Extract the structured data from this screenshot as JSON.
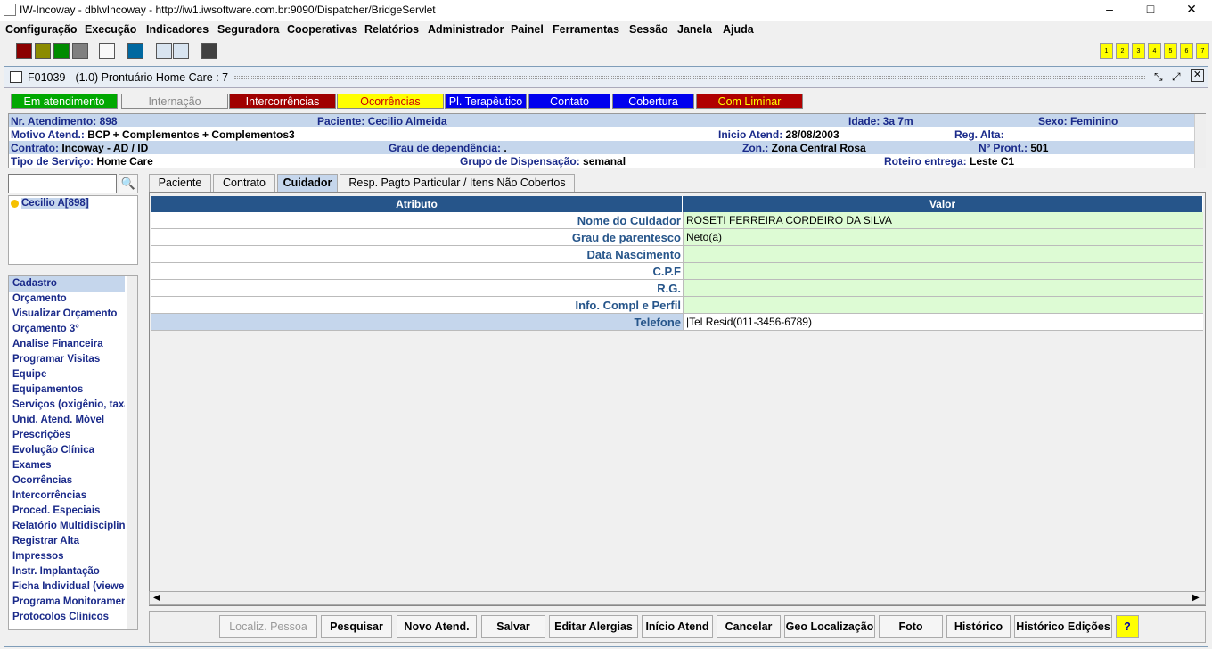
{
  "window": {
    "title": "IW-Incoway - dblwIncoway - http://iw1.iwsoftware.com.br:9090/Dispatcher/BridgeServlet",
    "min": "–",
    "max": "□",
    "close": "✕"
  },
  "menu": [
    "Configuração",
    "Execução",
    "Indicadores",
    "Seguradora",
    "Cooperativas",
    "Relatórios",
    "Administrador",
    "Painel",
    "Ferramentas",
    "Sessão",
    "Janela",
    "Ajuda"
  ],
  "toolbar": {
    "colors": [
      "#8b0000",
      "#8b8b00",
      "#008b00",
      "#808080",
      "#f8f8f8",
      "#0068a0",
      "#404040"
    ],
    "numbers": [
      "1",
      "2",
      "3",
      "4",
      "5",
      "6",
      "7"
    ]
  },
  "form": {
    "title": "F01039 - (1.0) Prontuário Home Care : 7"
  },
  "status_buttons": [
    {
      "label": "Em atendimento",
      "bg": "#00a800",
      "fg": "#ffffff"
    },
    {
      "label": "Internação",
      "bg": "#f0f0f0",
      "fg": "#888888"
    },
    {
      "label": "Intercorrências",
      "bg": "#a00000",
      "fg": "#ffffff"
    },
    {
      "label": "Ocorrências",
      "bg": "#ffff00",
      "fg": "#cc0000"
    },
    {
      "label": "Pl. Terapêutico",
      "bg": "#0000ee",
      "fg": "#ffffff"
    },
    {
      "label": "Contato",
      "bg": "#0000ee",
      "fg": "#ffffff"
    },
    {
      "label": "Cobertura",
      "bg": "#0000ee",
      "fg": "#ffffff"
    },
    {
      "label": "Com Liminar",
      "bg": "#b00000",
      "fg": "#ffff00"
    }
  ],
  "info": {
    "r1": {
      "a_k": "Nr. Atendimento:",
      "a_v": " 898",
      "b_k": "Paciente:",
      "b_v": " Cecilio Almeida",
      "c_k": "Idade:",
      "c_v": " 3a 7m",
      "d_k": "Sexo:",
      "d_v": " Feminino"
    },
    "r2": {
      "a_k": "Motivo Atend.:",
      "a_v": " BCP + Complementos + Complementos3",
      "b_k": "Inicio Atend:",
      "b_v": " 28/08/2003",
      "c_k": "Reg. Alta:",
      "c_v": ""
    },
    "r3": {
      "a_k": "Contrato:",
      "a_v": " Incoway - AD / ID",
      "b_k": "Grau de dependência:",
      "b_v": " .",
      "c_k": "Zon.:",
      "c_v": " Zona Central Rosa",
      "d_k": "Nº Pront.:",
      "d_v": " 501"
    },
    "r4": {
      "a_k": "Tipo de Serviço:",
      "a_v": " Home Care",
      "b_k": "Grupo de Dispensação:",
      "b_v": " semanal",
      "c_k": "Roteiro entrega:",
      "c_v": " Leste C1"
    }
  },
  "patient_tree": {
    "node": "Cecilio A[898]",
    "search_placeholder": ""
  },
  "side_menu": [
    "Cadastro",
    "Orçamento",
    "Visualizar Orçamento",
    "Orçamento 3°",
    "Analise Financeira",
    "Programar Visitas",
    "Equipe",
    "Equipamentos",
    "Serviços (oxigênio, taxa",
    "Unid. Atend. Móvel",
    "Prescrições",
    "Evolução Clínica",
    "Exames",
    "Ocorrências",
    "Intercorrências",
    "Proced. Especiais",
    "Relatório Multidisciplina",
    "Registrar Alta",
    "Impressos",
    "Instr. Implantação",
    "Ficha Individual (viewer",
    "Programa Monitoramen",
    "Protocolos Clínicos"
  ],
  "tabs": [
    "Paciente",
    "Contrato",
    "Cuidador",
    "Resp. Pagto Particular / Itens Não Cobertos"
  ],
  "grid": {
    "h_attr": "Atributo",
    "h_val": "Valor",
    "rows": [
      {
        "k": "Nome do Cuidador",
        "v": "ROSETI FERREIRA  CORDEIRO DA SILVA"
      },
      {
        "k": "Grau de parentesco",
        "v": "Neto(a)"
      },
      {
        "k": "Data Nascimento",
        "v": ""
      },
      {
        "k": "C.P.F",
        "v": ""
      },
      {
        "k": "R.G.",
        "v": ""
      },
      {
        "k": "Info. Compl e Perfil",
        "v": ""
      },
      {
        "k": "Telefone",
        "v": "|Tel Resid(011-3456-6789)"
      }
    ]
  },
  "bottom_buttons": [
    "Localiz. Pessoa",
    "Pesquisar",
    "Novo Atend.",
    "Salvar",
    "Editar Alergias",
    "Início Atend",
    "Cancelar",
    "Geo Localização",
    "Foto",
    "Histórico",
    "Histórico Edições",
    "?"
  ]
}
